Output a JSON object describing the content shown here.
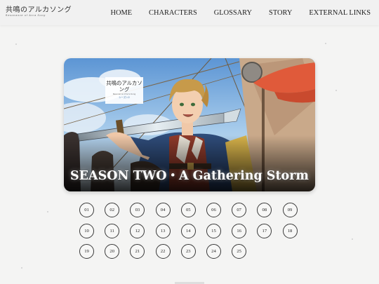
{
  "header": {
    "logo": "共鳴のアルカソング",
    "logo_sub": "Resonance of Arca Song",
    "nav": [
      "HOME",
      "CHARACTERS",
      "GLOSSARY",
      "STORY",
      "EXTERNAL LINKS"
    ]
  },
  "banner": {
    "badge_title": "共鳴のアルカソング",
    "badge_sub": "Resonance of Arca Song",
    "badge_season": "シーズン2",
    "title": "SEASON TWO・A Gathering Storm"
  },
  "episodes": [
    "01",
    "02",
    "03",
    "04",
    "05",
    "06",
    "07",
    "08",
    "09",
    "10",
    "11",
    "12",
    "13",
    "14",
    "15",
    "16",
    "17",
    "18",
    "19",
    "20",
    "21",
    "22",
    "23",
    "24",
    "25"
  ]
}
